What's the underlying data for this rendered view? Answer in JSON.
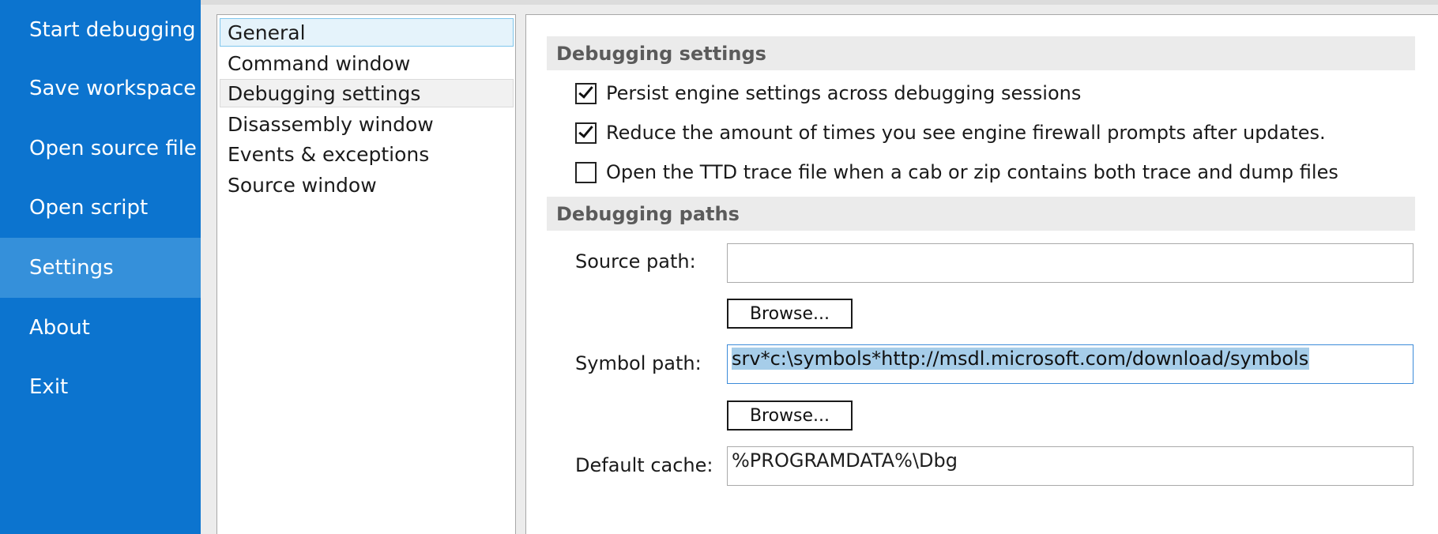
{
  "nav": {
    "items": [
      {
        "label": "Start debugging"
      },
      {
        "label": "Save workspace"
      },
      {
        "label": "Open source file"
      },
      {
        "label": "Open script"
      },
      {
        "label": "Settings",
        "active": true
      },
      {
        "label": "About"
      },
      {
        "label": "Exit"
      }
    ]
  },
  "categories": {
    "items": [
      {
        "label": "General",
        "state": "selected"
      },
      {
        "label": "Command window"
      },
      {
        "label": "Debugging settings",
        "state": "hover"
      },
      {
        "label": "Disassembly window"
      },
      {
        "label": "Events & exceptions"
      },
      {
        "label": "Source window"
      }
    ]
  },
  "settings": {
    "debugging_section": "Debugging settings",
    "checks": [
      {
        "label": "Persist engine settings across debugging sessions",
        "checked": true
      },
      {
        "label": "Reduce the amount of times you see engine firewall prompts after updates.",
        "checked": true
      },
      {
        "label": "Open the TTD trace file when a cab or zip contains both trace and dump files",
        "checked": false
      }
    ],
    "paths_section": "Debugging paths",
    "source_path": {
      "label": "Source path:",
      "value": "",
      "browse": "Browse..."
    },
    "symbol_path": {
      "label": "Symbol path:",
      "value": "srv*c:\\symbols*http://msdl.microsoft.com/download/symbols",
      "browse": "Browse..."
    },
    "default_cache": {
      "label": "Default cache:",
      "value": "%PROGRAMDATA%\\Dbg"
    }
  },
  "colors": {
    "nav_bg": "#0c74cf",
    "nav_active": "#3590da",
    "selection": "#a6cde9"
  }
}
